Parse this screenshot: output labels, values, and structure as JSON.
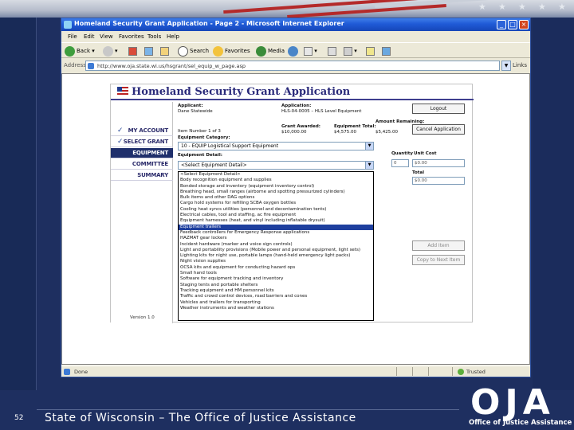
{
  "slide": {
    "number": "52",
    "footer_text": "State of Wisconsin – The Office of Justice Assistance",
    "logo_letters": "OJA",
    "logo_subtitle": "Office of Justice Assistance"
  },
  "browser": {
    "title": "Homeland Security Grant Application - Page 2 - Microsoft Internet Explorer",
    "menu": [
      "File",
      "Edit",
      "View",
      "Favorites",
      "Tools",
      "Help"
    ],
    "toolbar": {
      "back": "Back",
      "search": "Search",
      "favorites": "Favorites",
      "media": "Media"
    },
    "address_label": "Address",
    "address_url": "http://www.oja.state.wi.us/hsgrant/sel_equip_w_page.asp",
    "links_label": "Links",
    "status_text": "Done",
    "status_zone": "Trusted"
  },
  "app": {
    "title": "Homeland Security Grant Application",
    "nav": [
      {
        "label": "MY ACCOUNT",
        "checked": true
      },
      {
        "label": "SELECT GRANT",
        "checked": true
      },
      {
        "label": "EQUIPMENT",
        "active": true
      },
      {
        "label": "COMMITTEE"
      },
      {
        "label": "SUMMARY"
      }
    ],
    "version": "Version 1.0",
    "applicant_label": "Applicant:",
    "applicant_value": "Dane Statewide",
    "application_label": "Application:",
    "application_value": "HLS-04-0005 – HLS Level Equipment",
    "item_number": "Item Number 1 of 3",
    "grant_awarded_label": "Grant Awarded:",
    "grant_awarded_value": "$10,000.00",
    "equipment_total_label": "Equipment Total:",
    "equipment_total_value": "$4,575.00",
    "amount_remaining_label": "Amount Remaining:",
    "amount_remaining_value": "$5,425.00",
    "equipment_category_label": "Equipment Category:",
    "equipment_category_value": "10 - EQUIP Logistical Support Equipment",
    "equipment_detail_label": "Equipment Detail:",
    "equipment_detail_value": "<Select Equipment Detail>",
    "logout_button": "Logout",
    "cancel_button": "Cancel Application",
    "quantity_label": "Quantity",
    "quantity_value": "0",
    "unit_cost_label": "Unit Cost",
    "unit_cost_value": "$0.00",
    "vendor_label": "Vendor",
    "total_label": "Total",
    "total_value": "$0.00",
    "add_item_button": "Add Item",
    "copy_item_button": "Copy to Next Item",
    "dropdown_options": [
      "<Select Equipment Detail>",
      "Body recognition equipment and supplies",
      "Bonded storage and inventory (equipment inventory control)",
      "Breathing head, small ranges (airborne and spotting pressurized cylinders)",
      "Bulk items and other DAG options",
      "Cargo hold systems for refilling SCBA oxygen bottles",
      "Cooling heat syncs utilities (personnel and decontamination tents)",
      "Electrical cables, tool and staffing, ac fire equipment",
      "Equipment harnesses (heat, and vinyl including inflatable drysuit)",
      "Equipment trailers",
      "Feedback controllers for Emergency Response applications",
      "HAZMAT gear lockers",
      "Incident hardware (marker and voice sign controls)",
      "Light and portability provisions (Mobile power and personal equipment, light sets)",
      "Lighting kits for night use, portable lamps (hand-held emergency light packs)",
      "Night vision supplies",
      "OCSA kits and equipment for conducting hazard ops",
      "Small hand tools",
      "Software for equipment tracking and inventory",
      "Staging tents and portable shelters",
      "Tracking equipment and HM personnel kits",
      "Traffic and crowd control devices, road barriers and cones",
      "Vehicles and trailers for transporting",
      "Weather instruments and weather stations"
    ],
    "selected_option_index": 9
  }
}
